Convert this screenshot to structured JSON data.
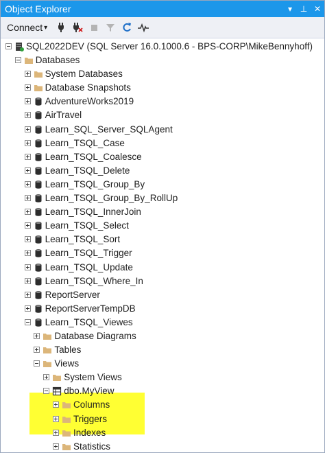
{
  "window": {
    "title": "Object Explorer",
    "pin_glyph": "⊥",
    "menu_glyph": "▾",
    "close_glyph": "✕"
  },
  "toolbar": {
    "connect_label": "Connect",
    "connect_glyph": "▾"
  },
  "colors": {
    "highlight": "#ffff33",
    "folder": "#dcb67a",
    "db": "#2d2d2d",
    "titlebar": "#1c97ea"
  },
  "tree": [
    {
      "label": "SQL2022DEV (SQL Server 16.0.1000.6 - BPS-CORP\\MikeBennyhoff)",
      "level": 0,
      "icon": "server-icon",
      "expander": "minus"
    },
    {
      "label": "Databases",
      "level": 1,
      "icon": "folder-icon",
      "expander": "minus"
    },
    {
      "label": "System Databases",
      "level": 2,
      "icon": "folder-icon",
      "expander": "plus"
    },
    {
      "label": "Database Snapshots",
      "level": 2,
      "icon": "folder-icon",
      "expander": "plus"
    },
    {
      "label": "AdventureWorks2019",
      "level": 2,
      "icon": "database-icon",
      "expander": "plus"
    },
    {
      "label": "AirTravel",
      "level": 2,
      "icon": "database-icon",
      "expander": "plus"
    },
    {
      "label": "Learn_SQL_Server_SQLAgent",
      "level": 2,
      "icon": "database-icon",
      "expander": "plus"
    },
    {
      "label": "Learn_TSQL_Case",
      "level": 2,
      "icon": "database-icon",
      "expander": "plus"
    },
    {
      "label": "Learn_TSQL_Coalesce",
      "level": 2,
      "icon": "database-icon",
      "expander": "plus"
    },
    {
      "label": "Learn_TSQL_Delete",
      "level": 2,
      "icon": "database-icon",
      "expander": "plus"
    },
    {
      "label": "Learn_TSQL_Group_By",
      "level": 2,
      "icon": "database-icon",
      "expander": "plus"
    },
    {
      "label": "Learn_TSQL_Group_By_RollUp",
      "level": 2,
      "icon": "database-icon",
      "expander": "plus"
    },
    {
      "label": "Learn_TSQL_InnerJoin",
      "level": 2,
      "icon": "database-icon",
      "expander": "plus"
    },
    {
      "label": "Learn_TSQL_Select",
      "level": 2,
      "icon": "database-icon",
      "expander": "plus"
    },
    {
      "label": "Learn_TSQL_Sort",
      "level": 2,
      "icon": "database-icon",
      "expander": "plus"
    },
    {
      "label": "Learn_TSQL_Trigger",
      "level": 2,
      "icon": "database-icon",
      "expander": "plus"
    },
    {
      "label": "Learn_TSQL_Update",
      "level": 2,
      "icon": "database-icon",
      "expander": "plus"
    },
    {
      "label": "Learn_TSQL_Where_In",
      "level": 2,
      "icon": "database-icon",
      "expander": "plus"
    },
    {
      "label": "ReportServer",
      "level": 2,
      "icon": "database-icon",
      "expander": "plus"
    },
    {
      "label": "ReportServerTempDB",
      "level": 2,
      "icon": "database-icon",
      "expander": "plus"
    },
    {
      "label": "Learn_TSQL_Viewes",
      "level": 2,
      "icon": "database-icon",
      "expander": "minus"
    },
    {
      "label": "Database Diagrams",
      "level": 3,
      "icon": "folder-icon",
      "expander": "plus"
    },
    {
      "label": "Tables",
      "level": 3,
      "icon": "folder-icon",
      "expander": "plus"
    },
    {
      "label": "Views",
      "level": 3,
      "icon": "folder-icon",
      "expander": "minus"
    },
    {
      "label": "System Views",
      "level": 4,
      "icon": "folder-icon",
      "expander": "plus"
    },
    {
      "label": "dbo.MyView",
      "level": 4,
      "icon": "view-icon",
      "expander": "minus"
    },
    {
      "label": "Columns",
      "level": 5,
      "icon": "folder-icon",
      "expander": "plus"
    },
    {
      "label": "Triggers",
      "level": 5,
      "icon": "folder-icon",
      "expander": "plus"
    },
    {
      "label": "Indexes",
      "level": 5,
      "icon": "folder-icon",
      "expander": "plus"
    },
    {
      "label": "Statistics",
      "level": 5,
      "icon": "folder-icon",
      "expander": "plus"
    }
  ]
}
